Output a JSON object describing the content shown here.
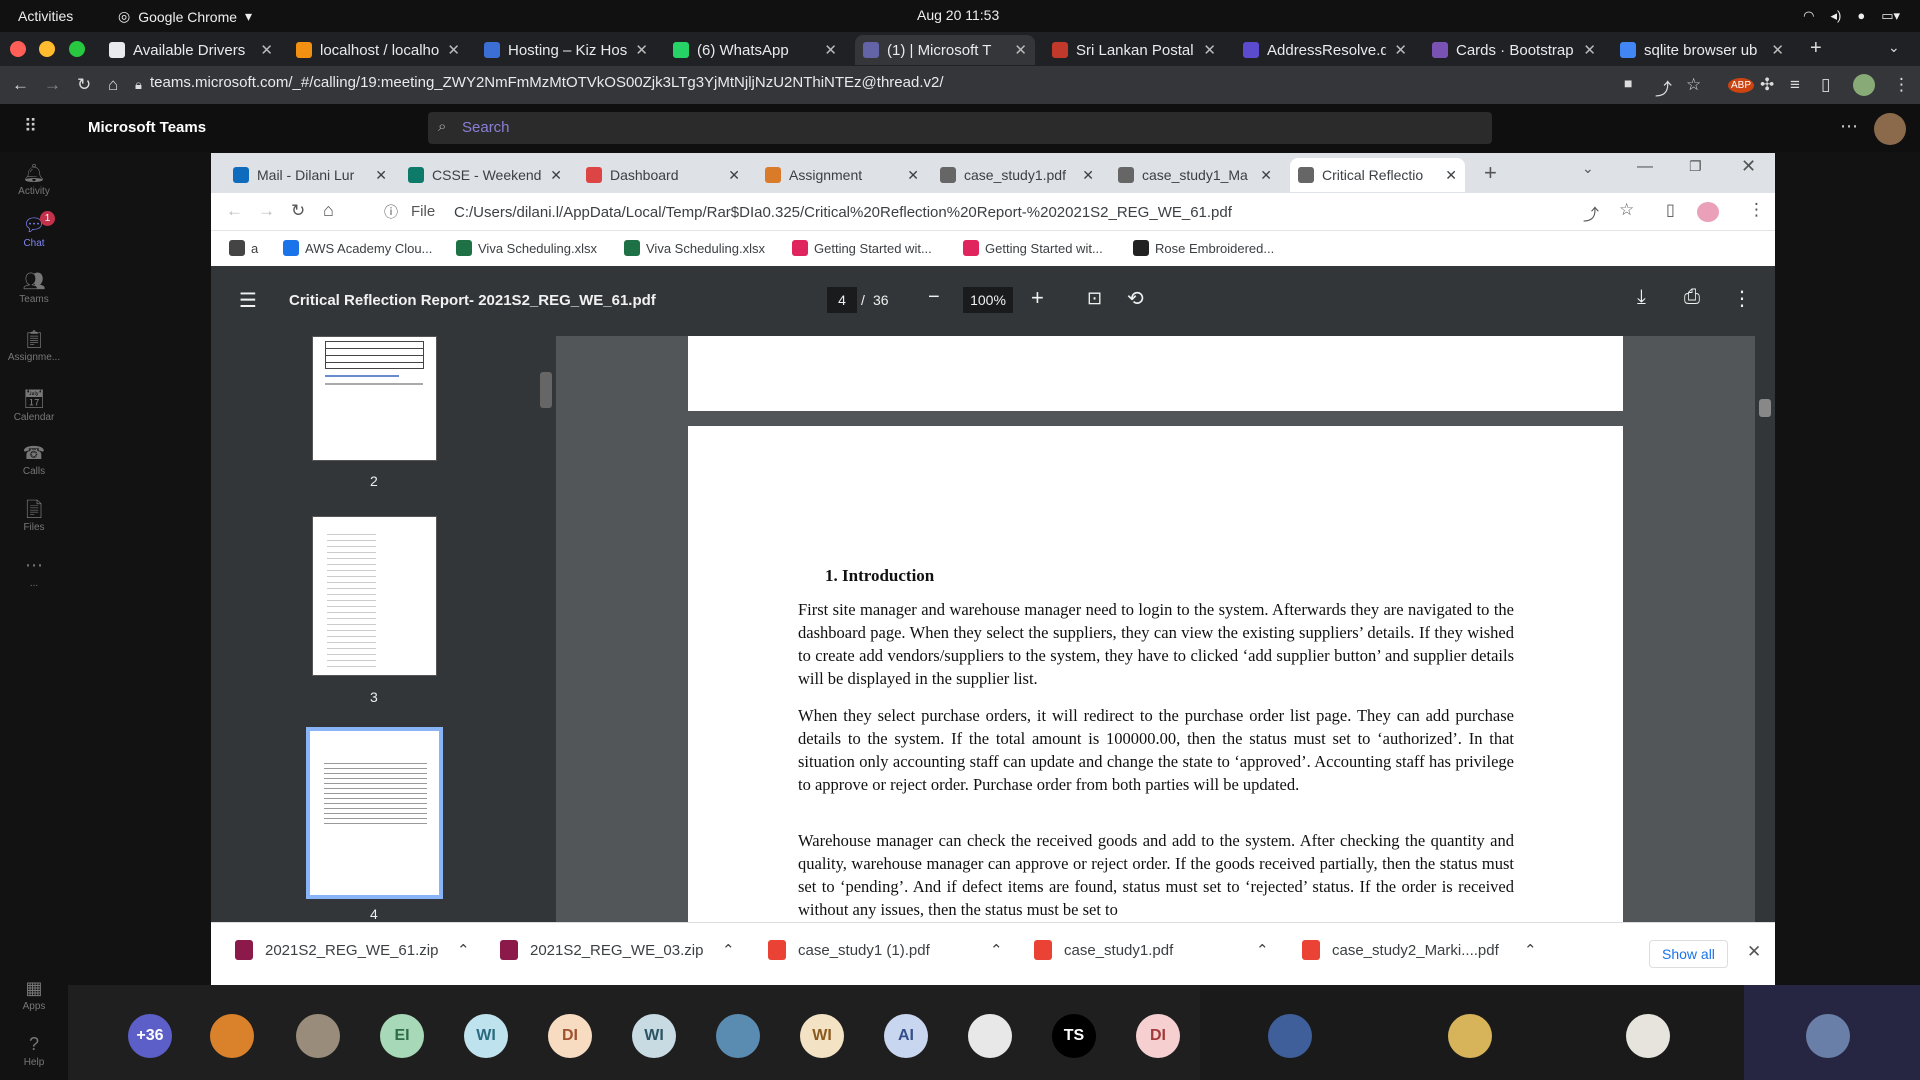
{
  "system": {
    "activities": "Activities",
    "app_name": "Google Chrome",
    "clock": "Aug 20  11:53"
  },
  "outer_browser": {
    "tabs": [
      {
        "label": "Available Drivers",
        "color": "#e8eaed"
      },
      {
        "label": "localhost / localho",
        "color": "#f29111"
      },
      {
        "label": "Hosting – Kiz Host",
        "color": "#3b6fd6"
      },
      {
        "label": "(6) WhatsApp",
        "color": "#25d366"
      },
      {
        "label": "(1) | Microsoft T",
        "color": "#6264a7"
      },
      {
        "label": "Sri Lankan Postal",
        "color": "#c0392b"
      },
      {
        "label": "AddressResolve.d",
        "color": "#5b4ccf"
      },
      {
        "label": "Cards · Bootstrap",
        "color": "#7952b3"
      },
      {
        "label": "sqlite browser ub",
        "color": "#4285f4"
      }
    ],
    "url": "teams.microsoft.com/_#/calling/19:meeting_ZWY2NmFmMzMtOTVkOS00Zjk3LTg3YjMtNjljNzU2NThiNTEz@thread.v2/"
  },
  "teams": {
    "title": "Microsoft Teams",
    "search_placeholder": "Search",
    "rail": [
      {
        "label": "Activity",
        "icon": "bell-icon",
        "glyph": "🔔︎"
      },
      {
        "label": "Chat",
        "icon": "chat-icon",
        "glyph": "💬︎",
        "badge": "1"
      },
      {
        "label": "Teams",
        "icon": "teams-icon",
        "glyph": "👥︎"
      },
      {
        "label": "Assignme...",
        "icon": "assignments-icon",
        "glyph": "📋︎"
      },
      {
        "label": "Calendar",
        "icon": "calendar-icon",
        "glyph": "📅︎"
      },
      {
        "label": "Calls",
        "icon": "phone-icon",
        "glyph": "☎"
      },
      {
        "label": "Files",
        "icon": "file-icon",
        "glyph": "📄︎"
      },
      {
        "label": "...",
        "icon": "more-icon",
        "glyph": ""
      }
    ],
    "rail_bottom": [
      {
        "label": "Apps",
        "glyph": "▦"
      },
      {
        "label": "Help",
        "glyph": "?"
      }
    ],
    "participants": [
      {
        "text": "+36",
        "bg": "#5b5fc7",
        "fg": "#fff"
      },
      {
        "text": "",
        "bg": "#d9822b",
        "fg": "#fff"
      },
      {
        "text": "",
        "bg": "#9a8c7a",
        "fg": "#fff"
      },
      {
        "text": "EI",
        "bg": "#a7d8b8",
        "fg": "#2e6b47"
      },
      {
        "text": "WI",
        "bg": "#bfe3ee",
        "fg": "#2b6a80"
      },
      {
        "text": "DI",
        "bg": "#f7dcc2",
        "fg": "#a0522d"
      },
      {
        "text": "WI",
        "bg": "#c8dbe3",
        "fg": "#2b5566"
      },
      {
        "text": "",
        "bg": "#5a8bb0",
        "fg": "#fff"
      },
      {
        "text": "WI",
        "bg": "#f4e2c4",
        "fg": "#8a5a1e"
      },
      {
        "text": "AI",
        "bg": "#c9d6f0",
        "fg": "#34508a"
      },
      {
        "text": "",
        "bg": "#e8e8e8",
        "fg": "#333"
      },
      {
        "text": "TS",
        "bg": "#000000",
        "fg": "#fff"
      },
      {
        "text": "DI",
        "bg": "#f6d0d0",
        "fg": "#a33a3a"
      },
      {
        "text": "",
        "bg": "#3f5f9a",
        "fg": "#fff"
      },
      {
        "text": "",
        "bg": "#d7b35a",
        "fg": "#fff"
      },
      {
        "text": "",
        "bg": "#e7e3dd",
        "fg": "#333"
      },
      {
        "text": "",
        "bg": "#6a7fa8",
        "fg": "#fff"
      }
    ]
  },
  "inner_browser": {
    "tabs": [
      {
        "label": "Mail - Dilani Lur",
        "color": "#0f6cbd"
      },
      {
        "label": "CSSE - Weekend",
        "color": "#0e7a6a"
      },
      {
        "label": "Dashboard",
        "color": "#d44"
      },
      {
        "label": "Assignment",
        "color": "#d97b28"
      },
      {
        "label": "case_study1.pdf",
        "color": "#666"
      },
      {
        "label": "case_study1_Ma",
        "color": "#666"
      },
      {
        "label": "Critical Reflectio",
        "color": "#666"
      }
    ],
    "file_label": "File",
    "url": "C:/Users/dilani.l/AppData/Local/Temp/Rar$DIa0.325/Critical%20Reflection%20Report-%202021S2_REG_WE_61.pdf",
    "bookmarks": [
      {
        "label": "a",
        "color": "#444"
      },
      {
        "label": "AWS Academy Clou...",
        "color": "#1a73e8"
      },
      {
        "label": "Viva Scheduling.xlsx",
        "color": "#1e7145"
      },
      {
        "label": "Viva Scheduling.xlsx",
        "color": "#1e7145"
      },
      {
        "label": "Getting Started wit...",
        "color": "#e0245e"
      },
      {
        "label": "Getting Started wit...",
        "color": "#e0245e"
      },
      {
        "label": "Rose Embroidered...",
        "color": "#222"
      }
    ]
  },
  "pdf": {
    "title": "Critical Reflection Report- 2021S2_REG_WE_61.pdf",
    "current_page": "4",
    "page_separator": "/",
    "total_pages": "36",
    "zoom": "100%",
    "thumbnail_numbers": [
      "2",
      "3",
      "4"
    ],
    "heading": "1.   Introduction",
    "paragraphs": [
      "First site manager and warehouse manager need to login to the system. Afterwards they are navigated to the dashboard page. When they select the suppliers, they can view the existing suppliers’ details. If they wished to create add vendors/suppliers to the system, they have to clicked ‘add supplier button’ and supplier details will be displayed in the supplier list.",
      "When they select purchase orders, it will redirect to the purchase order list page. They can add purchase details to the system. If the total amount is 100000.00, then the status must set to ‘authorized’. In that situation only accounting staff can update and change the state to ‘approved’. Accounting staff has privilege to approve or reject order. Purchase order from both parties will be updated.",
      "Warehouse manager can check the received goods and add to the system. After checking the quantity and quality, warehouse manager can approve or reject order. If the goods received partially, then the status must set to ‘pending’. And if defect items are found, status must set to ‘rejected’ status. If the order is received without any issues, then the status must be set to"
    ]
  },
  "downloads": {
    "items": [
      {
        "label": "2021S2_REG_WE_61.zip",
        "color": "#8b1a4a"
      },
      {
        "label": "2021S2_REG_WE_03.zip",
        "color": "#8b1a4a"
      },
      {
        "label": "case_study1 (1).pdf",
        "color": "#ea4335"
      },
      {
        "label": "case_study1.pdf",
        "color": "#ea4335"
      },
      {
        "label": "case_study2_Marki....pdf",
        "color": "#ea4335"
      }
    ],
    "show_all": "Show all"
  }
}
